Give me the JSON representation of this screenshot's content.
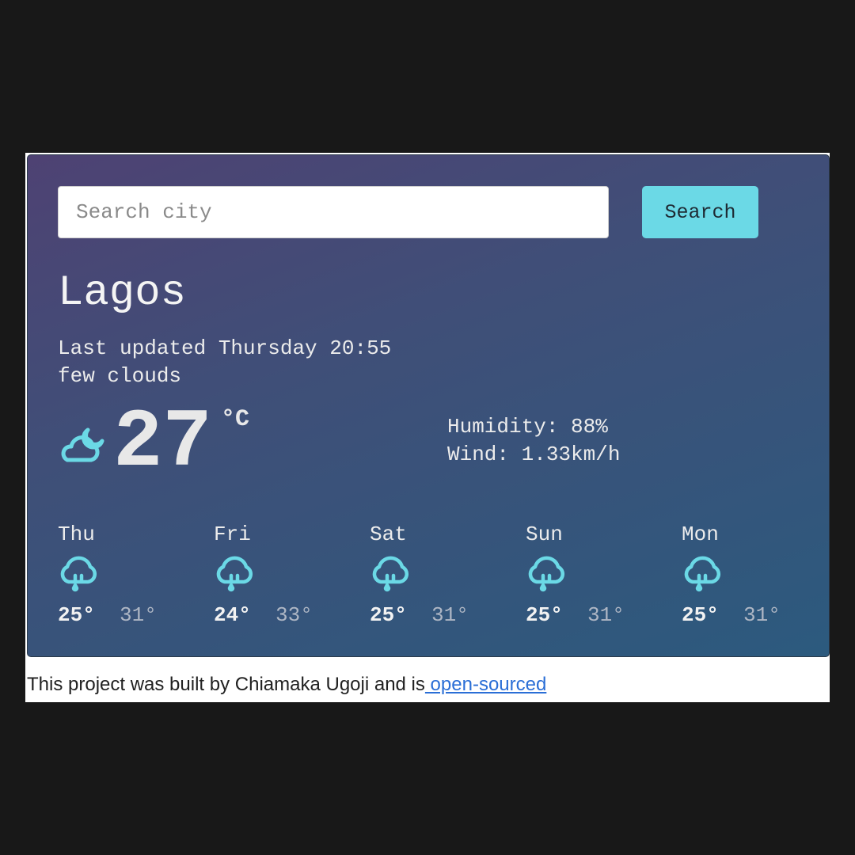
{
  "search": {
    "placeholder": "Search city",
    "button_label": "Search"
  },
  "current": {
    "city": "Lagos",
    "last_updated": "Last updated Thursday 20:55",
    "description": "few clouds",
    "icon": "cloud-night-icon",
    "temperature": "27",
    "unit": "°C",
    "humidity": "Humidity: 88%",
    "wind": "Wind: 1.33km/h"
  },
  "forecast": [
    {
      "day": "Thu",
      "icon": "rain-cloud-icon",
      "min": "25°",
      "max": "31°"
    },
    {
      "day": "Fri",
      "icon": "rain-cloud-icon",
      "min": "24°",
      "max": "33°"
    },
    {
      "day": "Sat",
      "icon": "rain-cloud-icon",
      "min": "25°",
      "max": "31°"
    },
    {
      "day": "Sun",
      "icon": "rain-cloud-icon",
      "min": "25°",
      "max": "31°"
    },
    {
      "day": "Mon",
      "icon": "rain-cloud-icon",
      "min": "25°",
      "max": "31°"
    }
  ],
  "footer": {
    "text": "This project was built by Chiamaka Ugoji and is",
    "link_label": " open-sourced"
  },
  "colors": {
    "accent": "#6bd9e6",
    "link": "#2a6ed6",
    "background": "#181818"
  }
}
